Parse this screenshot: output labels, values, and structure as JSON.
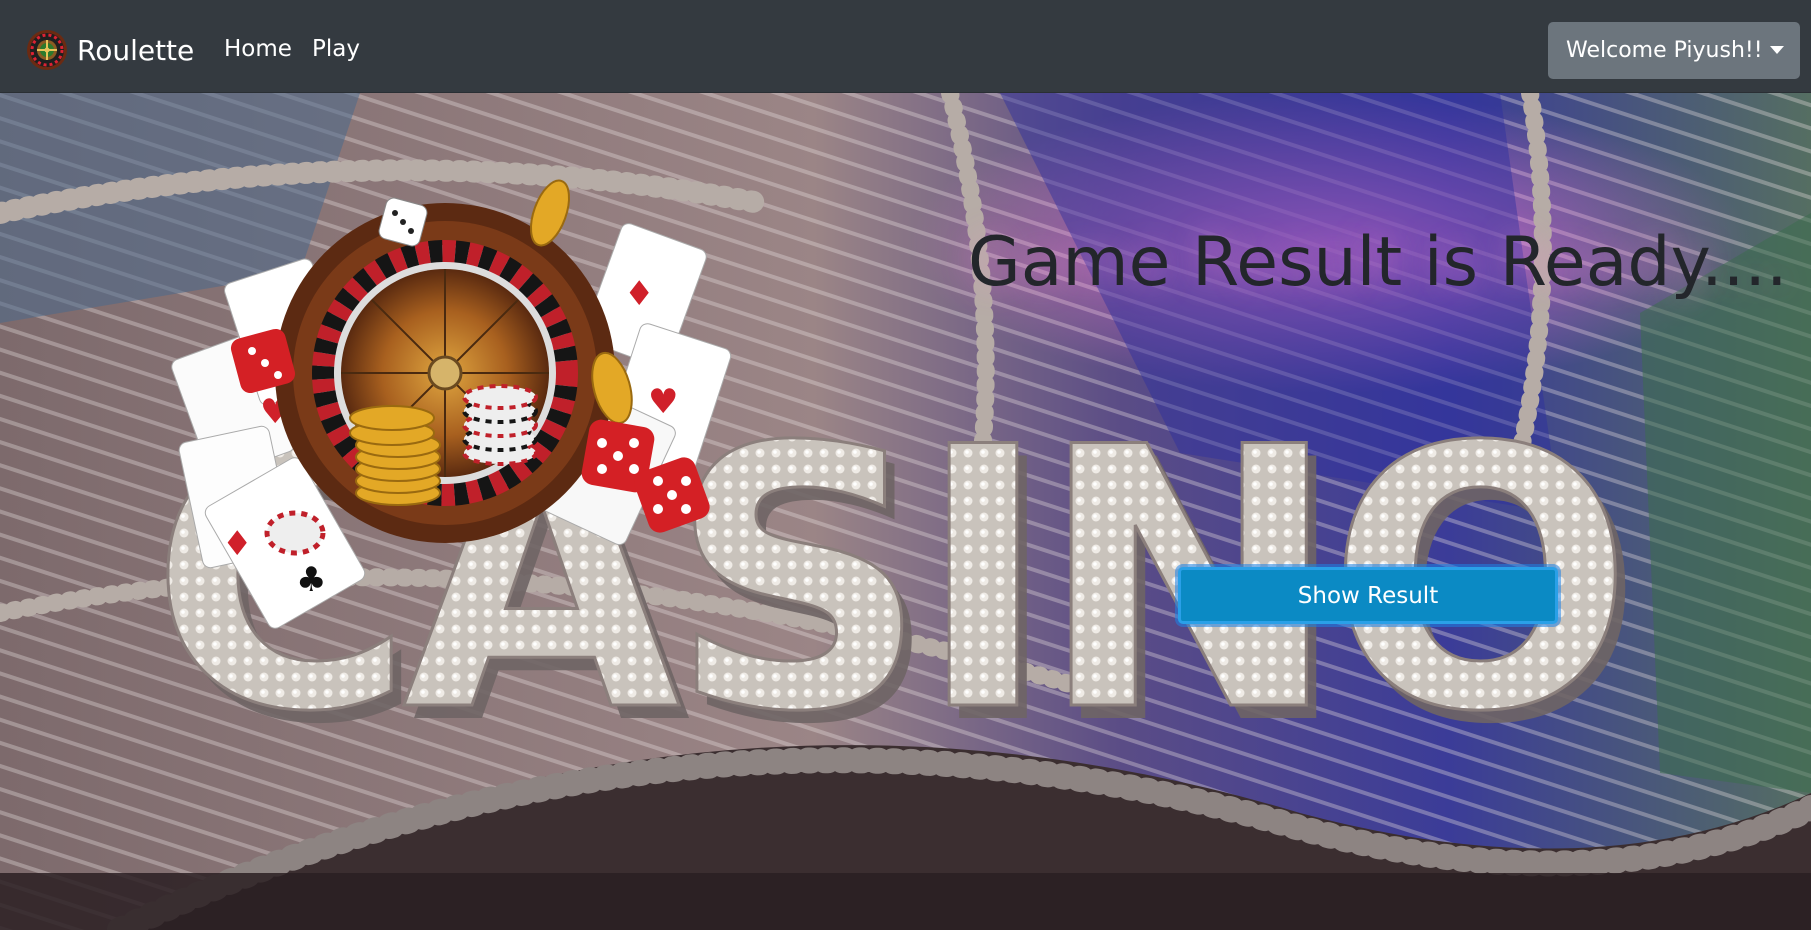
{
  "navbar": {
    "brand": "Roulette",
    "links": [
      "Home",
      "Play"
    ],
    "user_menu": "Welcome Piyush!!"
  },
  "hero": {
    "headline": "Game Result is Ready....",
    "button": "Show Result",
    "sign_text": "CASINO"
  },
  "colors": {
    "navbar_bg": "#343a40",
    "user_button_bg": "#6c757d",
    "primary_button_bg": "#0b8ac4",
    "headline_color": "#23262b"
  },
  "icons": [
    "roulette-wheel-icon",
    "dropdown-caret-icon"
  ]
}
